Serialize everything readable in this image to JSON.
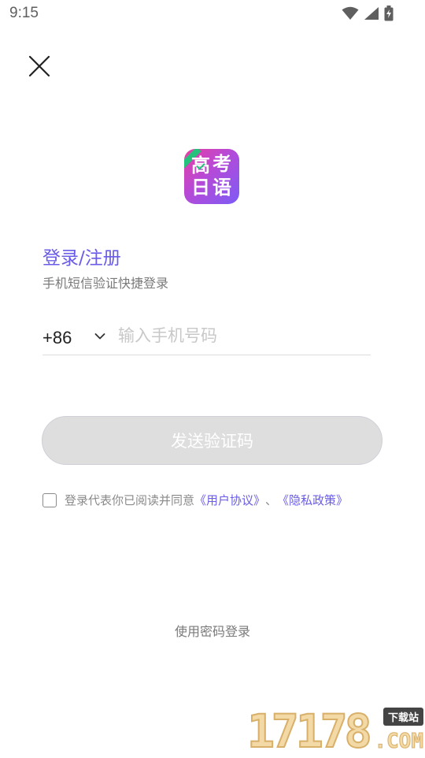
{
  "status_bar": {
    "time": "9:15",
    "icons": [
      "wifi-icon",
      "signal-icon",
      "battery-charging-icon"
    ]
  },
  "header": {
    "close_icon": "close-icon"
  },
  "logo": {
    "chars": [
      "高",
      "考",
      "日",
      "语"
    ],
    "colors": {
      "start": "#e73fa2",
      "end": "#7c5cf5",
      "ribbon": "#25c27b"
    }
  },
  "login": {
    "title": "登录/注册",
    "subtitle": "手机短信验证快捷登录",
    "country_code": "+86",
    "phone_placeholder": "输入手机号码",
    "phone_value": "",
    "send_code_label": "发送验证码",
    "agreement_prefix": "登录代表你已阅读并同意",
    "user_agreement_link": "《用户协议》",
    "separator": "、",
    "privacy_policy_link": "《隐私政策》",
    "agreement_checked": false,
    "password_login_label": "使用密码登录"
  },
  "watermark": {
    "digits": "17178",
    "tag": "下载站",
    "suffix": ".COM"
  },
  "colors": {
    "accent": "#6a5ce6",
    "button_disabled_bg": "#dedede",
    "muted_text": "#7a7a7a"
  }
}
